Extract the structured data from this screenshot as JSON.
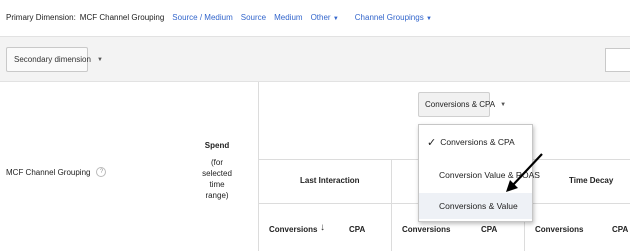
{
  "primary_dimension": {
    "label": "Primary Dimension:",
    "active": "MCF Channel Grouping",
    "links": [
      "Source / Medium",
      "Source",
      "Medium"
    ],
    "other": "Other",
    "channel_groupings": "Channel Groupings"
  },
  "toolbar": {
    "secondary_dimension": "Secondary dimension"
  },
  "table": {
    "row_header": "MCF Channel Grouping",
    "help_icon": "?",
    "spend_title": "Spend",
    "spend_sub_1": "(for selected time",
    "spend_sub_2": "range)",
    "model_selector": "Conversions & CPA",
    "columns": [
      "Last Interaction",
      "Time Decay"
    ],
    "subheaders": {
      "li_conversions": "Conversions",
      "li_cpa": "CPA",
      "mid_conversions": "Conversions",
      "mid_cpa": "CPA",
      "td_conversions": "Conversions",
      "td_cpa": "CPA"
    }
  },
  "menu": {
    "items": [
      {
        "label": "Conversions & CPA",
        "checked": true
      },
      {
        "label": "Conversion Value & ROAS",
        "checked": false
      },
      {
        "label": "Conversions & Value",
        "checked": false
      }
    ],
    "check_glyph": "✓"
  },
  "icons": {
    "caret": "dropdown-caret-icon",
    "sort": "sort-down-arrow-icon",
    "help": "help-icon",
    "annotation_arrow": "annotation-arrow-icon"
  }
}
